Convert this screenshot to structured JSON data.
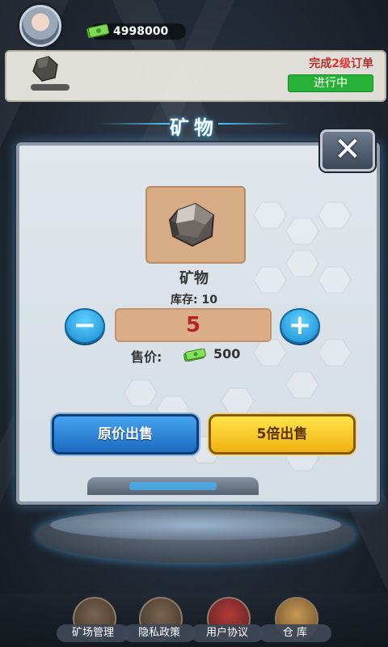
{
  "topbar": {
    "money": "4998000"
  },
  "order": {
    "title_prefix": "完成",
    "title_level": "2级",
    "title_suffix": "订单",
    "status": "进行中"
  },
  "dialog": {
    "title": "矿物",
    "close_glyph": "✕",
    "item_name": "矿物",
    "stock_label": "库存:",
    "stock_value": "10",
    "minus_glyph": "−",
    "plus_glyph": "+",
    "quantity": "5",
    "price_label": "售价:",
    "price_value": "500",
    "sell_normal": "原价出售",
    "sell_5x": "5倍出售"
  },
  "nav": {
    "items": [
      {
        "label": "矿场管理",
        "icon": "mine-icon"
      },
      {
        "label": "隐私政策",
        "icon": "scroll-icon"
      },
      {
        "label": "用户协议",
        "icon": "book-icon"
      },
      {
        "label": "仓 库",
        "icon": "warehouse-icon"
      }
    ]
  },
  "colors": {
    "accent_blue": "#1b69bf",
    "accent_gold": "#f0b210",
    "status_green": "#27b137",
    "qty_red": "#b3262a"
  }
}
